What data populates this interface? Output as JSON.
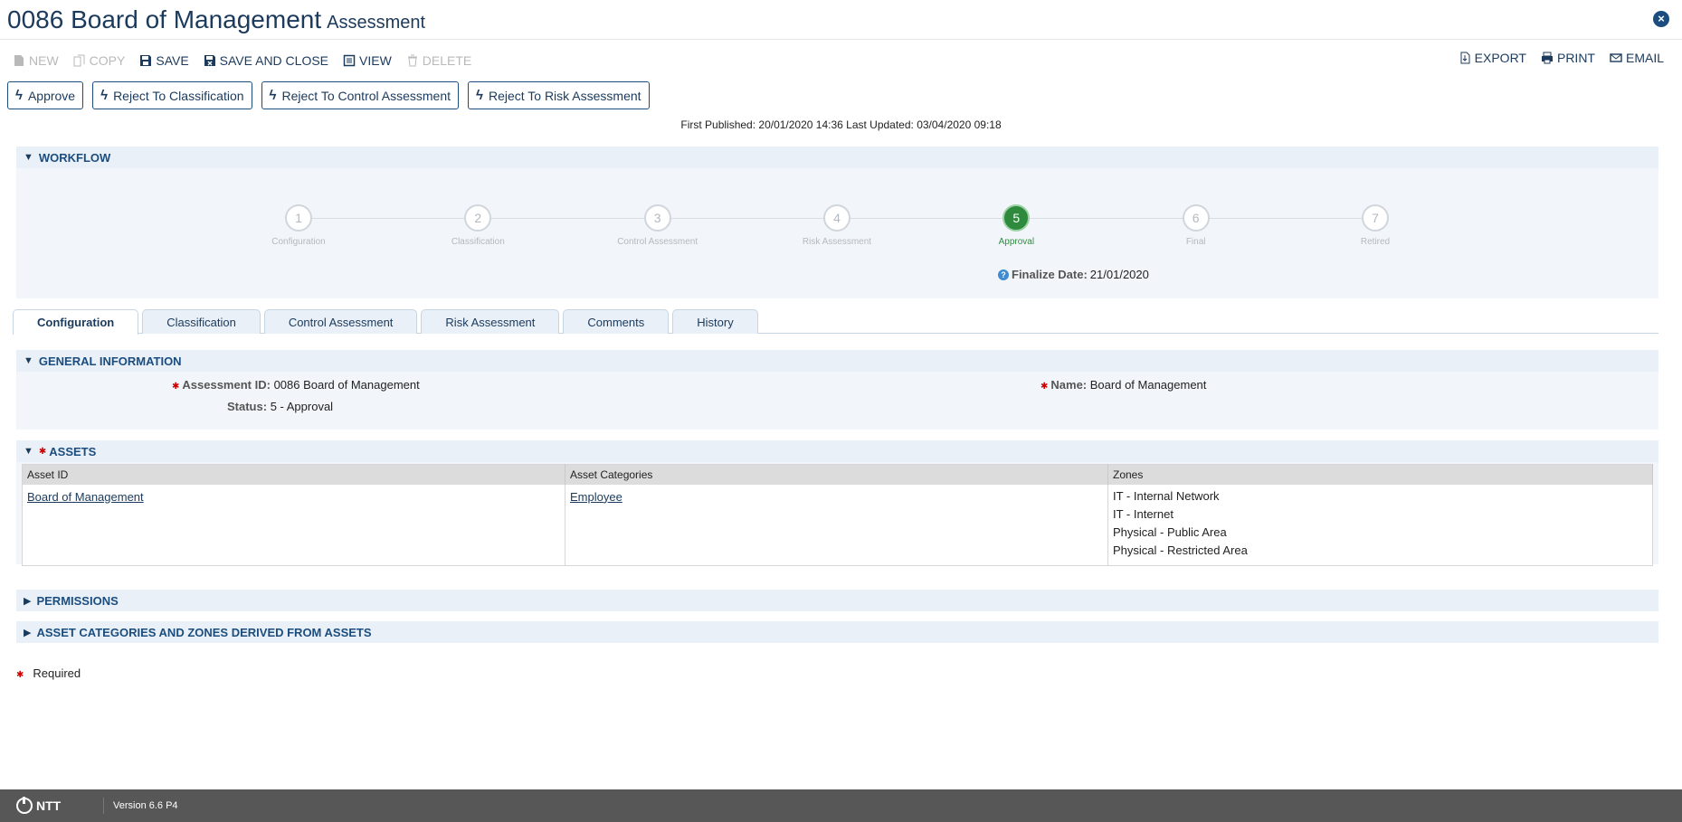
{
  "header": {
    "title": "0086 Board of Management",
    "subtitle": "Assessment"
  },
  "toolbar": {
    "new": "NEW",
    "copy": "COPY",
    "save": "SAVE",
    "save_close": "SAVE AND CLOSE",
    "view": "VIEW",
    "delete": "DELETE",
    "export": "EXPORT",
    "print": "PRINT",
    "email": "EMAIL"
  },
  "actions": {
    "approve": "Approve",
    "reject_classification": "Reject To Classification",
    "reject_control": "Reject To Control Assessment",
    "reject_risk": "Reject To Risk Assessment"
  },
  "published_info": "First Published: 20/01/2020 14:36 Last Updated: 03/04/2020 09:18",
  "workflow": {
    "heading": "WORKFLOW",
    "steps": [
      {
        "num": "1",
        "label": "Configuration"
      },
      {
        "num": "2",
        "label": "Classification"
      },
      {
        "num": "3",
        "label": "Control Assessment"
      },
      {
        "num": "4",
        "label": "Risk Assessment"
      },
      {
        "num": "5",
        "label": "Approval"
      },
      {
        "num": "6",
        "label": "Final"
      },
      {
        "num": "7",
        "label": "Retired"
      }
    ],
    "active_step": 5,
    "finalize_label": "Finalize Date:",
    "finalize_value": "21/01/2020"
  },
  "tabs": [
    "Configuration",
    "Classification",
    "Control Assessment",
    "Risk Assessment",
    "Comments",
    "History"
  ],
  "general": {
    "heading": "GENERAL INFORMATION",
    "assessment_id_label": "Assessment ID:",
    "assessment_id_value": "0086 Board of Management",
    "name_label": "Name:",
    "name_value": "Board of Management",
    "status_label": "Status:",
    "status_value": "5 - Approval"
  },
  "assets": {
    "heading": "ASSETS",
    "columns": [
      "Asset ID",
      "Asset Categories",
      "Zones"
    ],
    "row": {
      "asset_id": "Board of Management",
      "category": "Employee",
      "zones": [
        "IT - Internal Network",
        "IT - Internet",
        "Physical - Public Area",
        "Physical - Restricted Area"
      ]
    }
  },
  "permissions": {
    "heading": "PERMISSIONS"
  },
  "derived": {
    "heading": "ASSET CATEGORIES AND ZONES DERIVED FROM ASSETS"
  },
  "required_note": "Required",
  "footer": {
    "logo": "NTT",
    "version": "Version 6.6 P4"
  },
  "colors": {
    "accent": "#1b4d7e",
    "active_step": "#2e8b3e",
    "footer_bg": "#575757"
  }
}
